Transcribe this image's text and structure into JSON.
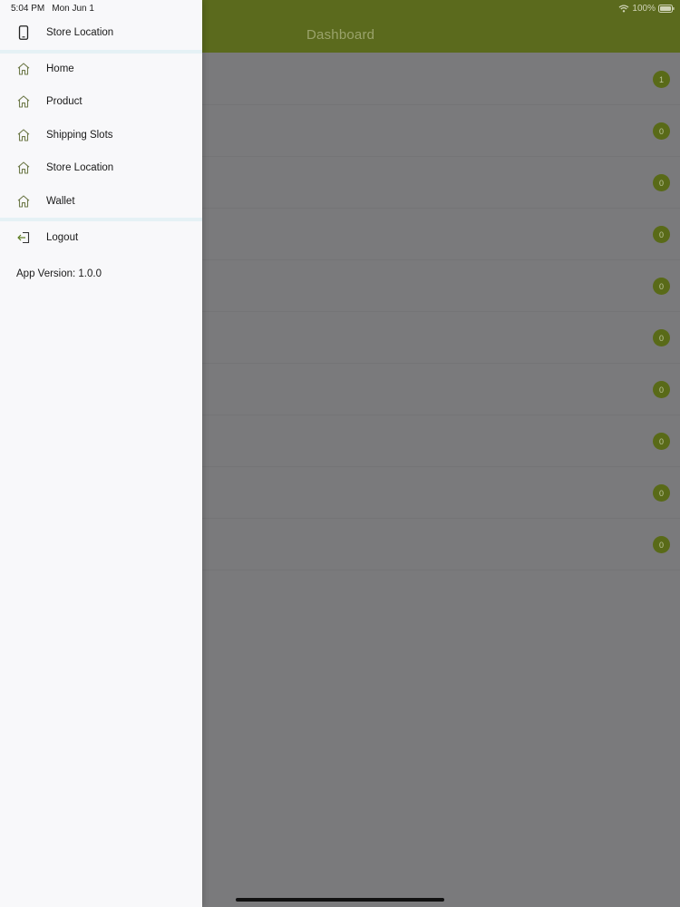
{
  "status_bar": {
    "time": "5:04 PM",
    "date": "Mon Jun 1",
    "battery": "100%",
    "wifi_icon": "wifi-icon",
    "battery_icon": "battery-icon"
  },
  "app": {
    "title": "Dashboard",
    "badges": [
      "1",
      "0",
      "0",
      "0",
      "0",
      "0",
      "0",
      "0",
      "0",
      "0"
    ],
    "colors": {
      "header": "#5b6a1d",
      "badge": "#596a18"
    }
  },
  "drawer": {
    "header_item": {
      "label": "Store Location",
      "icon": "phone-icon"
    },
    "items": [
      {
        "label": "Home",
        "icon": "home-icon"
      },
      {
        "label": "Product",
        "icon": "home-icon"
      },
      {
        "label": "Shipping Slots",
        "icon": "home-icon"
      },
      {
        "label": "Store Location",
        "icon": "home-icon"
      },
      {
        "label": "Wallet",
        "icon": "home-icon"
      }
    ],
    "logout": {
      "label": "Logout",
      "icon": "logout-icon"
    },
    "version": "App Version: 1.0.0",
    "colors": {
      "divider": "#e5f1f5",
      "background": "#f8f8fa"
    }
  }
}
